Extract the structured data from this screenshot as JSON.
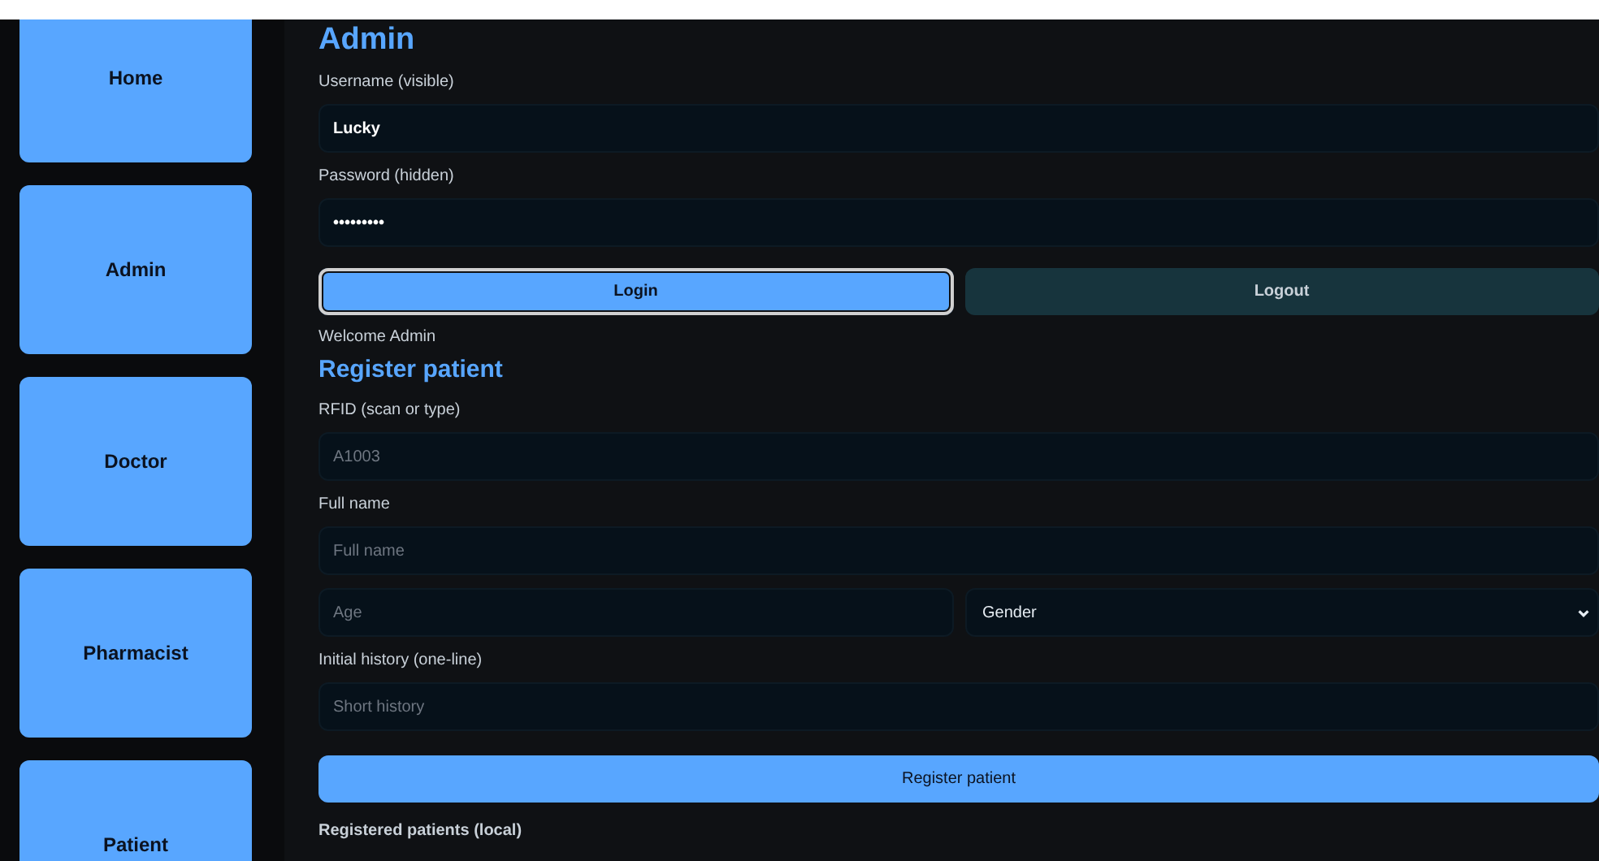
{
  "sidebar": {
    "items": [
      {
        "label": "Home"
      },
      {
        "label": "Admin"
      },
      {
        "label": "Doctor"
      },
      {
        "label": "Pharmacist"
      },
      {
        "label": "Patient"
      }
    ]
  },
  "login": {
    "title": "Admin",
    "fields": [
      {
        "label": "Username (visible)",
        "value": "Lucky"
      },
      {
        "label": "Password (hidden)",
        "value": "•••••••••"
      }
    ],
    "buttons": [
      {
        "label": "Login",
        "kind": "primary",
        "focused": true
      },
      {
        "label": "Logout",
        "kind": "secondary",
        "focused": false
      }
    ],
    "status": "Welcome Admin"
  },
  "register": {
    "title": "Register patient",
    "rfid": {
      "label": "RFID (scan or type)",
      "placeholder": "A1003"
    },
    "full_name": {
      "label": "Full name",
      "placeholder": "Full name"
    },
    "age": {
      "placeholder": "Age"
    },
    "gender": {
      "value": "Gender"
    },
    "history": {
      "label": "Initial history (one-line)",
      "placeholder": "Short history"
    },
    "button": "Register patient",
    "list_title": "Registered patients (local)"
  }
}
